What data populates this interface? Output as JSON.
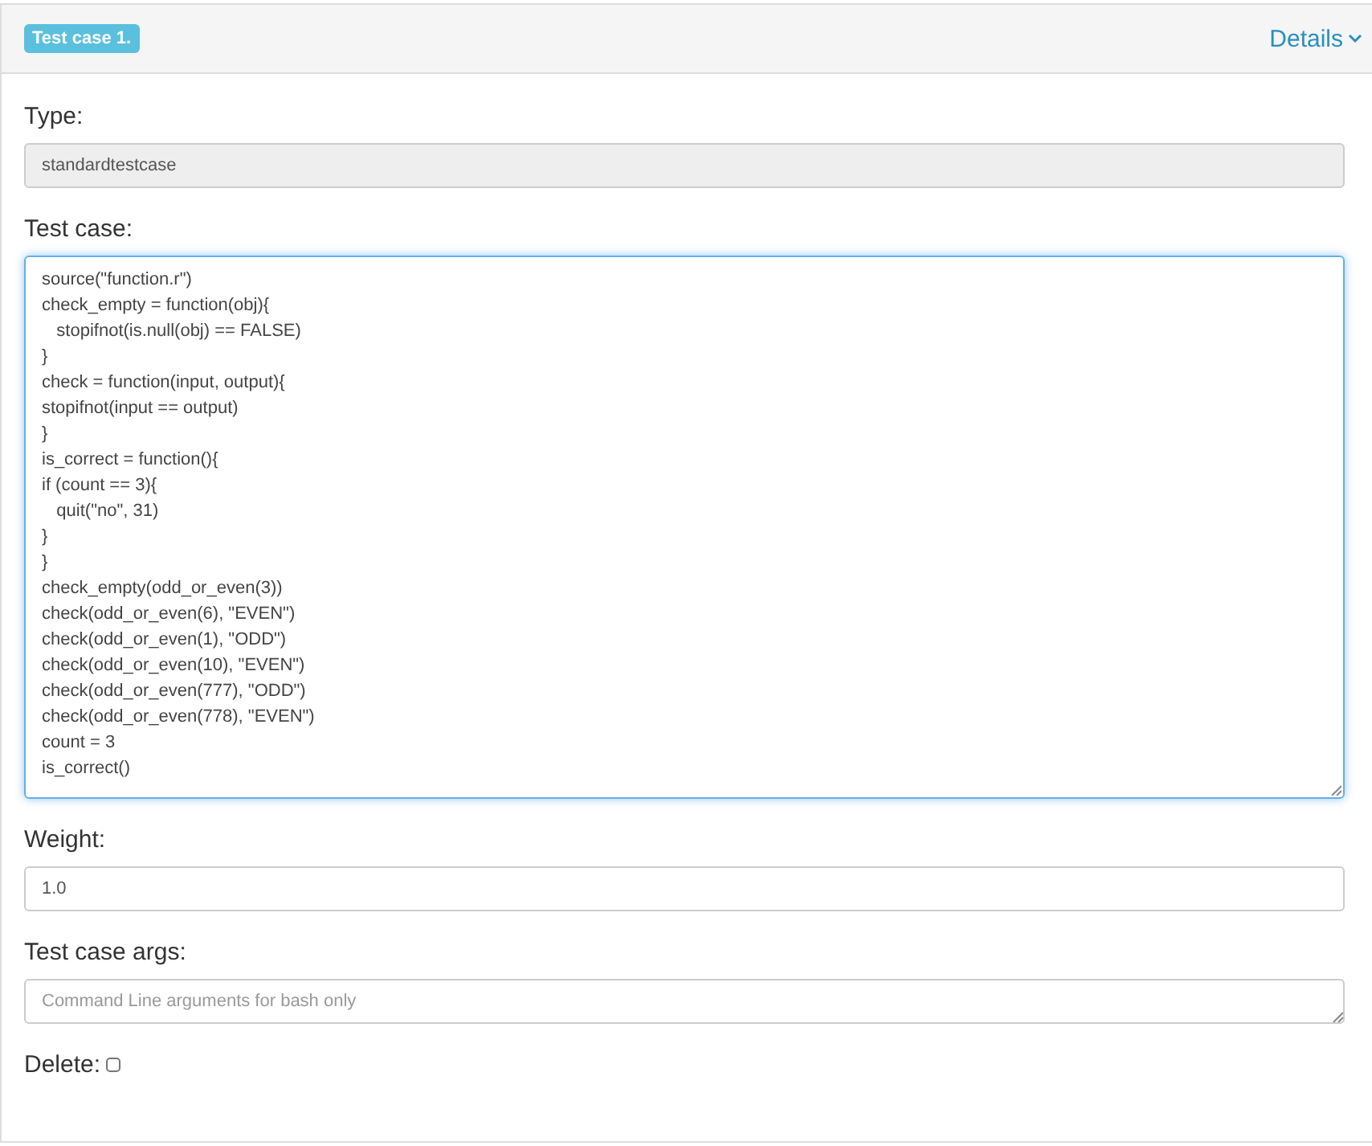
{
  "header": {
    "badge": "Test case 1.",
    "details_link": "Details"
  },
  "type_field": {
    "label": "Type:",
    "value": "standardtestcase",
    "disabled": true
  },
  "test_case": {
    "label": "Test case:",
    "focused": true,
    "lines": [
      "source(\"function.r\")",
      "check_empty = function(obj){",
      "   stopifnot(is.null(obj) == FALSE)",
      "}",
      "check = function(input, output){",
      "stopifnot(input == output)",
      "}",
      "is_correct = function(){",
      "if (count == 3){",
      "   quit(\"no\", 31)",
      "}",
      "}",
      "check_empty(odd_or_even(3))",
      "check(odd_or_even(6), \"EVEN\")",
      "check(odd_or_even(1), \"ODD\")",
      "check(odd_or_even(10), \"EVEN\")",
      "check(odd_or_even(777), \"ODD\")",
      "check(odd_or_even(778), \"EVEN\")",
      "count = 3",
      "is_correct()"
    ]
  },
  "weight": {
    "label": "Weight:",
    "value": "1.0"
  },
  "args": {
    "label": "Test case args:",
    "placeholder": "Command Line arguments for bash only"
  },
  "delete": {
    "label": "Delete:",
    "checked": false
  }
}
